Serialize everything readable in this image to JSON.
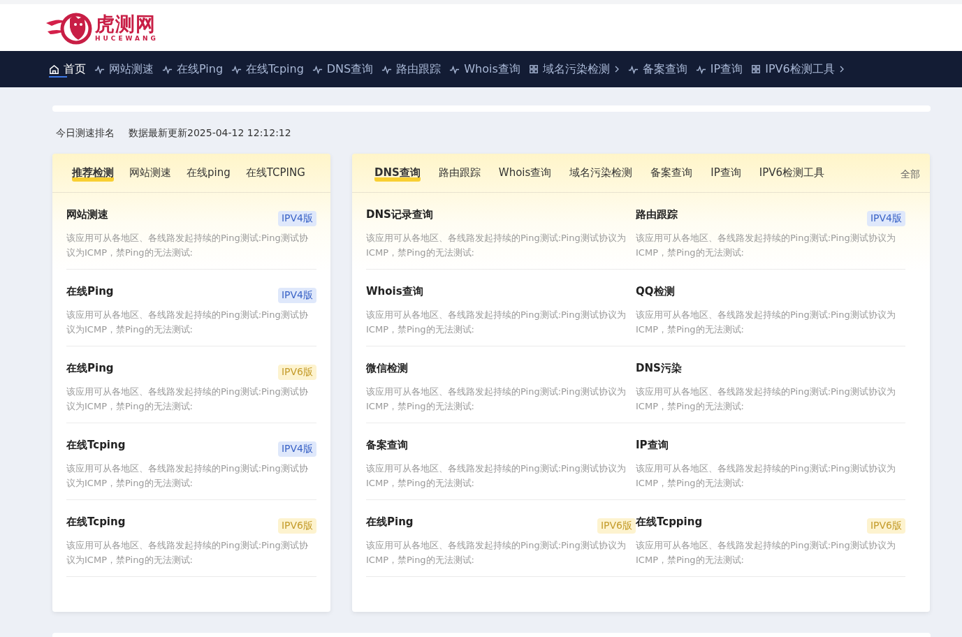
{
  "logo": {
    "name": "虎测网",
    "subtitle": "HUCEWANG"
  },
  "nav": [
    {
      "label": "首页",
      "kind": "home",
      "selected": true,
      "submenu": false
    },
    {
      "label": "网站测速",
      "kind": "tool",
      "selected": false,
      "submenu": false
    },
    {
      "label": "在线Ping",
      "kind": "tool",
      "selected": false,
      "submenu": false
    },
    {
      "label": "在线Tcping",
      "kind": "tool",
      "selected": false,
      "submenu": false
    },
    {
      "label": "DNS查询",
      "kind": "tool",
      "selected": false,
      "submenu": false
    },
    {
      "label": "路由跟踪",
      "kind": "tool",
      "selected": false,
      "submenu": false
    },
    {
      "label": "Whois查询",
      "kind": "tool",
      "selected": false,
      "submenu": false
    },
    {
      "label": "域名污染检测",
      "kind": "group",
      "selected": false,
      "submenu": true
    },
    {
      "label": "备案查询",
      "kind": "tool",
      "selected": false,
      "submenu": false
    },
    {
      "label": "IP查询",
      "kind": "tool",
      "selected": false,
      "submenu": false
    },
    {
      "label": "IPV6检测工具",
      "kind": "group",
      "selected": false,
      "submenu": true
    }
  ],
  "info": {
    "ranking": "今日测速排名",
    "updated": "数据最新更新2025-04-12 12:12:12"
  },
  "left_card": {
    "tabs": [
      {
        "label": "推荐检测",
        "selected": true
      },
      {
        "label": "网站测速",
        "selected": false
      },
      {
        "label": "在线ping",
        "selected": false
      },
      {
        "label": "在线TCPING",
        "selected": false
      }
    ],
    "items": [
      {
        "title": "网站测速",
        "badge": "IPV4版",
        "kind": "ipv4",
        "description": "该应用可从各地区、各线路发起持续的Ping测试:Ping测试协议为ICMP，禁Ping的无法测试:"
      },
      {
        "title": "在线Ping",
        "badge": "IPV4版",
        "kind": "ipv4",
        "description": "该应用可从各地区、各线路发起持续的Ping测试:Ping测试协议为ICMP，禁Ping的无法测试:"
      },
      {
        "title": "在线Ping",
        "badge": "IPV6版",
        "kind": "ipv6",
        "description": "该应用可从各地区、各线路发起持续的Ping测试:Ping测试协议为ICMP，禁Ping的无法测试:"
      },
      {
        "title": "在线Tcping",
        "badge": "IPV4版",
        "kind": "ipv4",
        "description": "该应用可从各地区、各线路发起持续的Ping测试:Ping测试协议为ICMP，禁Ping的无法测试:"
      },
      {
        "title": "在线Tcping",
        "badge": "IPV6版",
        "kind": "ipv6",
        "description": "该应用可从各地区、各线路发起持续的Ping测试:Ping测试协议为ICMP，禁Ping的无法测试:"
      }
    ]
  },
  "right_card": {
    "tabs": [
      {
        "label": "DNS查询",
        "selected": true
      },
      {
        "label": "路由跟踪",
        "selected": false
      },
      {
        "label": "Whois查询",
        "selected": false
      },
      {
        "label": "域名污染检测",
        "selected": false
      },
      {
        "label": "备案查询",
        "selected": false
      },
      {
        "label": "IP查询",
        "selected": false
      },
      {
        "label": "IPV6检测工具",
        "selected": false
      }
    ],
    "all_link": "全部",
    "items": [
      {
        "title": "DNS记录查询",
        "kind": "plain",
        "description": "该应用可从各地区、各线路发起持续的Ping测试:Ping测试协议为ICMP，禁Ping的无法测试:"
      },
      {
        "title": "路由跟踪",
        "badge": "IPV4版",
        "kind": "ipv4",
        "description": "该应用可从各地区、各线路发起持续的Ping测试:Ping测试协议为ICMP，禁Ping的无法测试:"
      },
      {
        "title": "Whois查询",
        "kind": "plain",
        "description": "该应用可从各地区、各线路发起持续的Ping测试:Ping测试协议为ICMP，禁Ping的无法测试:"
      },
      {
        "title": "QQ检测",
        "kind": "plain",
        "description": "该应用可从各地区、各线路发起持续的Ping测试:Ping测试协议为ICMP，禁Ping的无法测试:"
      },
      {
        "title": "微信检测",
        "kind": "plain",
        "description": "该应用可从各地区、各线路发起持续的Ping测试:Ping测试协议为ICMP，禁Ping的无法测试:"
      },
      {
        "title": "DNS污染",
        "kind": "plain",
        "description": "该应用可从各地区、各线路发起持续的Ping测试:Ping测试协议为ICMP，禁Ping的无法测试:"
      },
      {
        "title": "备案查询",
        "kind": "plain",
        "description": "该应用可从各地区、各线路发起持续的Ping测试:Ping测试协议为ICMP，禁Ping的无法测试:"
      },
      {
        "title": "IP查询",
        "kind": "plain",
        "description": "该应用可从各地区、各线路发起持续的Ping测试:Ping测试协议为ICMP，禁Ping的无法测试:"
      },
      {
        "title": "在线Ping",
        "badge": "IPV6版",
        "kind": "ipv6",
        "description": "该应用可从各地区、各线路发起持续的Ping测试:Ping测试协议为ICMP，禁Ping的无法测试:"
      },
      {
        "title": "在线Tcpping",
        "badge": "IPV6版",
        "kind": "ipv6",
        "description": "该应用可从各地区、各线路发起持续的Ping测试:Ping测试协议为ICMP，禁Ping的无法测试:"
      }
    ]
  }
}
